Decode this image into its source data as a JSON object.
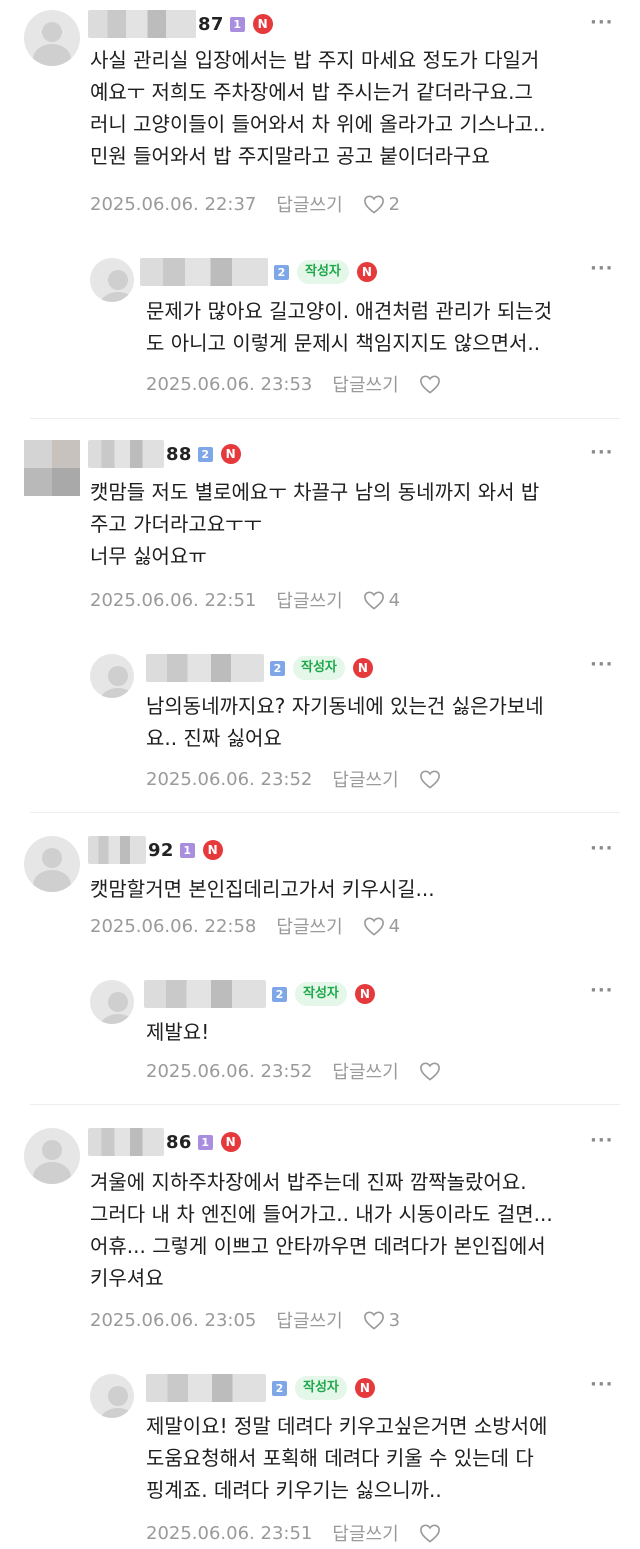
{
  "comments": [
    {
      "nick_suffix": "87",
      "level": "1",
      "text": "사실 관리실 입장에서는 밥 주지 마세요 정도가 다일거\n예요ㅜ 저희도 주차장에서 밥 주시는거 같더라구요.그\n러니 고양이들이 들어와서 차 위에 올라가고 기스나고..\n민원 들어와서 밥 주지말라고 공고 붙이더라구요",
      "date": "2025.06.06. 22:37",
      "reply": "답글쓰기",
      "likes": "2"
    },
    {
      "level": "2",
      "author_badge": "작성자",
      "text": "문제가 많아요 길고양이. 애견처럼 관리가 되는것\n도 아니고 이렇게 문제시 책임지지도 않으면서..",
      "date": "2025.06.06. 23:53",
      "reply": "답글쓰기"
    },
    {
      "nick_suffix": "88",
      "level": "2",
      "text": "캣맘들 저도 별로에요ㅜ 차끌구 남의 동네까지 와서 밥\n주고 가더라고요ㅜㅜ\n너무 싫어요ㅠ",
      "date": "2025.06.06. 22:51",
      "reply": "답글쓰기",
      "likes": "4"
    },
    {
      "level": "2",
      "author_badge": "작성자",
      "text": "남의동네까지요? 자기동네에 있는건 싫은가보네\n요.. 진짜 싫어요",
      "date": "2025.06.06. 23:52",
      "reply": "답글쓰기"
    },
    {
      "nick_suffix": "92",
      "level": "1",
      "text": "캣맘할거면 본인집데리고가서 키우시길...",
      "date": "2025.06.06. 22:58",
      "reply": "답글쓰기",
      "likes": "4"
    },
    {
      "level": "2",
      "author_badge": "작성자",
      "text": "제발요!",
      "date": "2025.06.06. 23:52",
      "reply": "답글쓰기"
    },
    {
      "nick_suffix": "86",
      "level": "1",
      "text": "겨울에 지하주차장에서 밥주는데 진짜 깜짝놀랐어요.\n그러다 내 차 엔진에 들어가고.. 내가 시동이라도 걸면...\n어휴... 그렇게 이쁘고 안타까우면 데려다가 본인집에서\n키우셔요",
      "date": "2025.06.06. 23:05",
      "reply": "답글쓰기",
      "likes": "3"
    },
    {
      "level": "2",
      "author_badge": "작성자",
      "text": "제말이요! 정말 데려다 키우고싶은거면 소방서에\n도움요청해서 포획해 데려다 키울 수 있는데 다\n핑계죠. 데려다 키우기는 싫으니까..",
      "date": "2025.06.06. 23:51",
      "reply": "답글쓰기"
    }
  ],
  "n_badge": "N",
  "more_glyph": "···"
}
